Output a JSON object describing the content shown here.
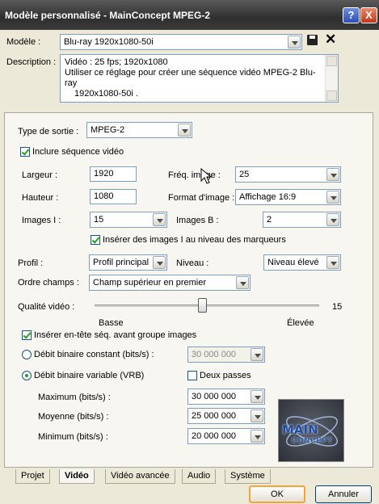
{
  "window": {
    "title": "Modèle personnalisé - MainConcept MPEG-2",
    "help": "?",
    "close": "X"
  },
  "top": {
    "model_label": "Modèle :",
    "model_value": "Blu-ray 1920x1080-50i",
    "desc_label": "Description :",
    "desc_line1": "Vidéo : 25 fps; 1920x1080",
    "desc_line2": "Utiliser ce réglage pour créer une séquence vidéo MPEG-2 Blu-ray",
    "desc_line3": "1920x1080-50i ."
  },
  "video": {
    "output_type_label": "Type de sortie :",
    "output_type_value": "MPEG-2",
    "include_video": "Inclure séquence vidéo",
    "width_label": "Largeur :",
    "width_value": "1920",
    "height_label": "Hauteur :",
    "height_value": "1080",
    "framerate_label": "Fréq. image :",
    "framerate_value": "25",
    "aspect_label": "Format d'image :",
    "aspect_value": "Affichage 16:9",
    "iframes_label": "Images I :",
    "iframes_value": "15",
    "bframes_label": "Images B :",
    "bframes_value": "2",
    "insert_iframes": "Insérer des images I au niveau des marqueurs",
    "profile_label": "Profil :",
    "profile_value": "Profil principal",
    "level_label": "Niveau :",
    "level_value": "Niveau élevé",
    "field_order_label": "Ordre champs :",
    "field_order_value": "Champ supérieur en premier",
    "quality_label": "Qualité vidéo :",
    "quality_value": "15",
    "quality_level_fraction": 0.48,
    "quality_low": "Basse",
    "quality_high": "Élevée",
    "insert_header": "Insérer en-tête séq. avant groupe images",
    "cbr_label": "Débit binaire constant (bits/s) :",
    "cbr_value": "30 000 000",
    "vbr_label": "Débit binaire variable (VRB)",
    "two_pass": "Deux passes",
    "max_label": "Maximum (bits/s) :",
    "max_value": "30 000 000",
    "avg_label": "Moyenne (bits/s) :",
    "avg_value": "25 000 000",
    "min_label": "Minimum (bits/s) :",
    "min_value": "20 000 000",
    "logo_main": "MAIN",
    "logo_concept": "CONCEPT"
  },
  "tabs": [
    "Projet",
    "Vidéo",
    "Vidéo avancée",
    "Audio",
    "Système"
  ],
  "buttons": {
    "ok": "OK",
    "cancel": "Annuler"
  }
}
